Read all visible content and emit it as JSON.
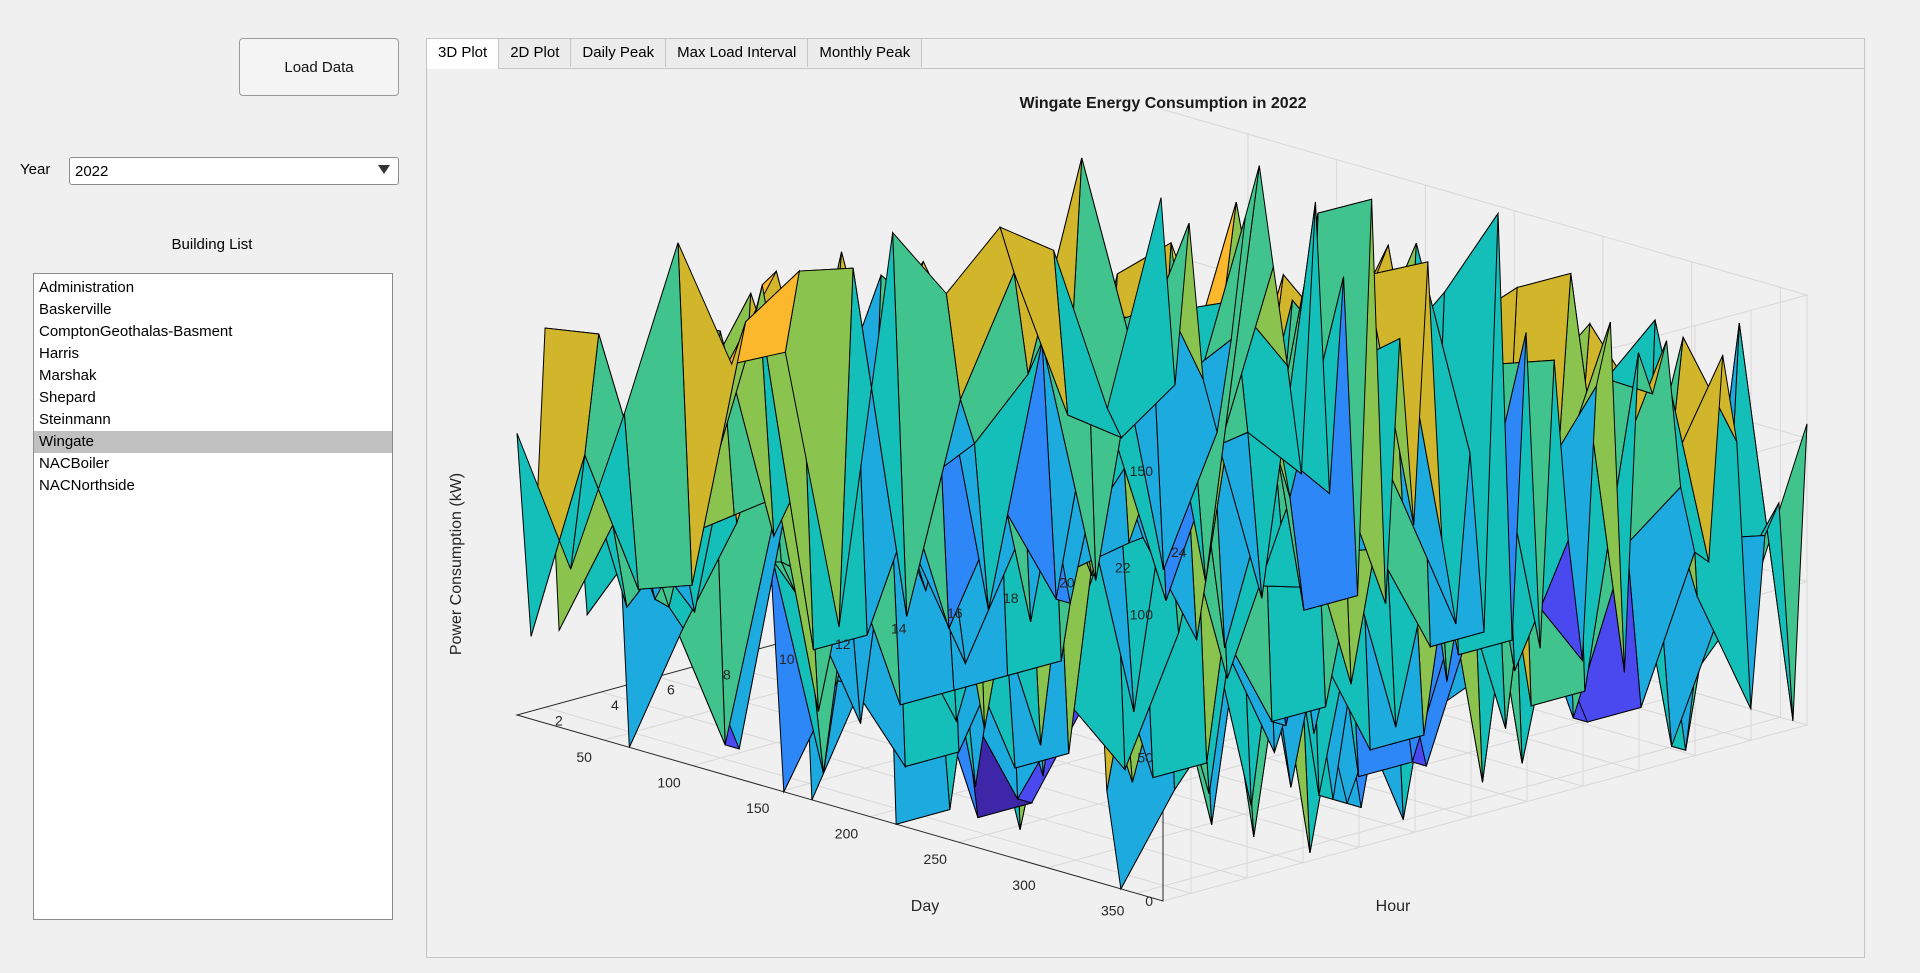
{
  "controls": {
    "load_button": "Load Data",
    "year_label": "Year",
    "year_value": "2022",
    "list_title": "Building List",
    "selected_building": "Wingate",
    "buildings": [
      "Administration",
      "Baskerville",
      "ComptonGeothalas-Basment",
      "Harris",
      "Marshak",
      "Shepard",
      "Steinmann",
      "Wingate",
      "NACBoiler",
      "NACNorthside"
    ]
  },
  "tabs": [
    "3D Plot",
    "2D Plot",
    "Daily Peak",
    "Max Load Interval",
    "Monthly Peak"
  ],
  "active_tab": "3D Plot",
  "chart_data": {
    "type": "surface",
    "title": "Wingate Energy Consumption in 2022",
    "xlabel": "Day",
    "ylabel": "Hour",
    "zlabel": "Power Consumption (kW)",
    "x_ticks": [
      50,
      100,
      150,
      200,
      250,
      300,
      350
    ],
    "y_ticks": [
      2,
      4,
      6,
      8,
      10,
      12,
      14,
      16,
      18,
      20,
      22,
      24
    ],
    "z_ticks": [
      0,
      50,
      100,
      150
    ],
    "xlim": [
      1,
      365
    ],
    "ylim": [
      1,
      24
    ],
    "zlim": [
      0,
      150
    ],
    "colormap": [
      "#3e26a8",
      "#4a49f0",
      "#2e87f7",
      "#1caadf",
      "#14beb9",
      "#40c38c",
      "#8bc34f",
      "#d1b52b",
      "#fcb82c",
      "#f5e61b",
      "#f9fb0e"
    ]
  }
}
